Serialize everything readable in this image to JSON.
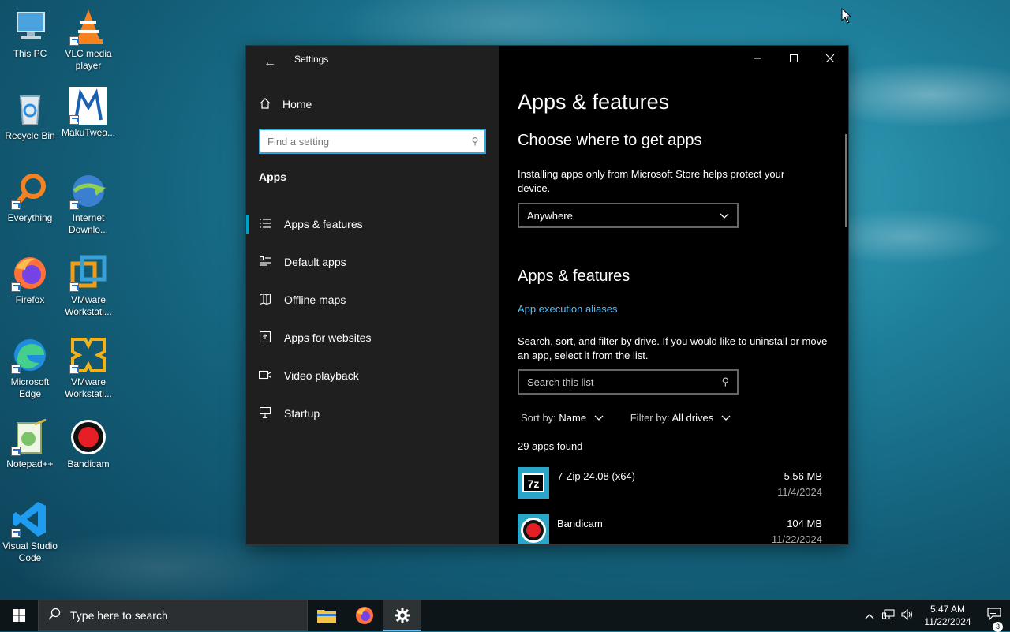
{
  "desktop": {
    "icons": [
      {
        "label": "This PC"
      },
      {
        "label": "VLC media player"
      },
      {
        "label": "Recycle Bin"
      },
      {
        "label": "MakuTwea..."
      },
      {
        "label": "Everything"
      },
      {
        "label": "Internet Downlo..."
      },
      {
        "label": "Firefox"
      },
      {
        "label": "VMware Workstati..."
      },
      {
        "label": "Microsoft Edge"
      },
      {
        "label": "VMware Workstati..."
      },
      {
        "label": "Notepad++"
      },
      {
        "label": "Bandicam"
      },
      {
        "label": "Visual Studio Code"
      }
    ]
  },
  "settings": {
    "title": "Settings",
    "home_label": "Home",
    "search_placeholder": "Find a setting",
    "section": "Apps",
    "nav": [
      {
        "label": "Apps & features",
        "icon": "list-icon",
        "active": true
      },
      {
        "label": "Default apps",
        "icon": "default-apps-icon",
        "active": false
      },
      {
        "label": "Offline maps",
        "icon": "map-icon",
        "active": false
      },
      {
        "label": "Apps for websites",
        "icon": "website-icon",
        "active": false
      },
      {
        "label": "Video playback",
        "icon": "video-icon",
        "active": false
      },
      {
        "label": "Startup",
        "icon": "startup-icon",
        "active": false
      }
    ],
    "main": {
      "page_title": "Apps & features",
      "choose_heading": "Choose where to get apps",
      "choose_desc": "Installing apps only from Microsoft Store helps protect your device.",
      "source_value": "Anywhere",
      "apps_heading": "Apps & features",
      "aliases_link": "App execution aliases",
      "search_desc": "Search, sort, and filter by drive. If you would like to uninstall or move an app, select it from the list.",
      "list_search_placeholder": "Search this list",
      "sort_label": "Sort by:",
      "sort_value": "Name",
      "filter_label": "Filter by:",
      "filter_value": "All drives",
      "count": "29 apps found",
      "apps": [
        {
          "name": "7-Zip 24.08 (x64)",
          "size": "5.56 MB",
          "date": "11/4/2024"
        },
        {
          "name": "Bandicam",
          "size": "104 MB",
          "date": "11/22/2024"
        }
      ]
    }
  },
  "taskbar": {
    "search_placeholder": "Type here to search",
    "time": "5:47 AM",
    "date": "11/22/2024",
    "notification_count": "3"
  },
  "colors": {
    "accent": "#00a1c9",
    "link": "#4cc2ff",
    "sidebar_bg": "#1f1f1f",
    "main_bg": "#000000"
  }
}
